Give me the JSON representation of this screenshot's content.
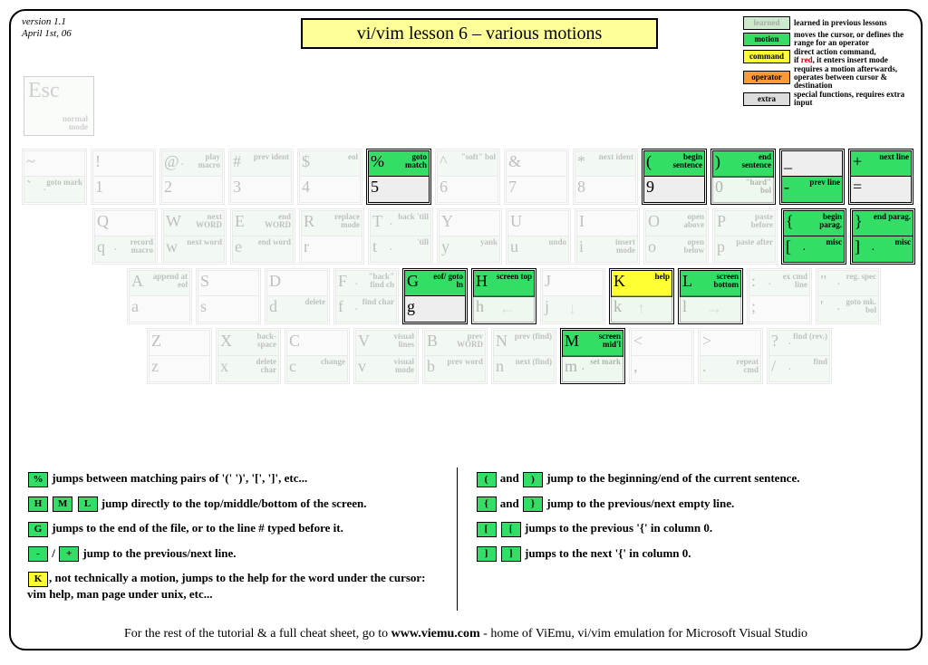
{
  "version": "version 1.1",
  "date": "April 1st, 06",
  "title": "vi/vim lesson 6 – various motions",
  "legend": {
    "learned": {
      "label": "learned",
      "text": "learned in previous lessons"
    },
    "motion": {
      "label": "motion",
      "text": "moves the cursor, or defines the range for an operator"
    },
    "command": {
      "label": "command",
      "text": "direct action command,"
    },
    "command2": "if",
    "command3": "red",
    "command4": ", it enters insert mode",
    "operator": {
      "label": "operator",
      "text": "requires a motion afterwards, operates between cursor & destination"
    },
    "extra": {
      "label": "extra",
      "text": "special functions, requires extra input"
    }
  },
  "esc": {
    "key": "Esc",
    "label": "normal\nmode"
  },
  "row1": [
    {
      "top": {
        "k": "~",
        "lbl": ""
      },
      "bot": {
        "k": "`",
        "lbl": "goto mark",
        "dot": "·"
      },
      "cls": "faded",
      "tcls": "c-blank",
      "bcls": "c-learned"
    },
    {
      "top": {
        "k": "!",
        "lbl": ""
      },
      "bot": {
        "k": "1",
        "lbl": ""
      },
      "cls": "faded",
      "tcls": "c-blank",
      "bcls": "c-blank"
    },
    {
      "top": {
        "k": "@",
        "lbl": "play macro",
        "dot": "·"
      },
      "bot": {
        "k": "2",
        "lbl": ""
      },
      "cls": "faded",
      "tcls": "c-learned",
      "bcls": "c-blank"
    },
    {
      "top": {
        "k": "#",
        "lbl": "prev ident"
      },
      "bot": {
        "k": "3",
        "lbl": ""
      },
      "cls": "faded",
      "tcls": "c-learned",
      "bcls": "c-blank"
    },
    {
      "top": {
        "k": "$",
        "lbl": "eol"
      },
      "bot": {
        "k": "4",
        "lbl": ""
      },
      "cls": "faded",
      "tcls": "c-learned",
      "bcls": "c-blank"
    },
    {
      "top": {
        "k": "%",
        "lbl": "goto match"
      },
      "bot": {
        "k": "5",
        "lbl": ""
      },
      "cls": "active",
      "tcls": "c-motion",
      "bcls": "c-blank"
    },
    {
      "top": {
        "k": "^",
        "lbl": "\"soft\" bol"
      },
      "bot": {
        "k": "6",
        "lbl": ""
      },
      "cls": "faded",
      "tcls": "c-learned",
      "bcls": "c-blank"
    },
    {
      "top": {
        "k": "&",
        "lbl": ""
      },
      "bot": {
        "k": "7",
        "lbl": ""
      },
      "cls": "faded",
      "tcls": "c-blank",
      "bcls": "c-blank"
    },
    {
      "top": {
        "k": "*",
        "lbl": "next ident"
      },
      "bot": {
        "k": "8",
        "lbl": ""
      },
      "cls": "faded",
      "tcls": "c-learned",
      "bcls": "c-blank"
    },
    {
      "top": {
        "k": "(",
        "lbl": "begin sentence"
      },
      "bot": {
        "k": "9",
        "lbl": ""
      },
      "cls": "active",
      "tcls": "c-motion",
      "bcls": "c-blank"
    },
    {
      "top": {
        "k": ")",
        "lbl": "end sentence"
      },
      "bot": {
        "k": "0",
        "lbl": "\"hard\" bol"
      },
      "cls": "active",
      "tcls": "c-motion",
      "bcls": "c-learned fadedhalf"
    },
    {
      "top": {
        "k": "_",
        "lbl": ""
      },
      "bot": {
        "k": "-",
        "lbl": "prev line"
      },
      "cls": "active",
      "tcls": "c-blank",
      "bcls": "c-motion"
    },
    {
      "top": {
        "k": "+",
        "lbl": "next line"
      },
      "bot": {
        "k": "=",
        "lbl": ""
      },
      "cls": "active",
      "tcls": "c-motion",
      "bcls": "c-blank"
    }
  ],
  "row2": [
    {
      "top": {
        "k": "Q",
        "lbl": ""
      },
      "bot": {
        "k": "q",
        "lbl": "record macro",
        "dot": "·"
      },
      "cls": "faded",
      "tcls": "c-blank",
      "bcls": "c-learned"
    },
    {
      "top": {
        "k": "W",
        "lbl": "next WORD"
      },
      "bot": {
        "k": "w",
        "lbl": "next word"
      },
      "cls": "faded",
      "tcls": "c-learned",
      "bcls": "c-learned"
    },
    {
      "top": {
        "k": "E",
        "lbl": "end WORD"
      },
      "bot": {
        "k": "e",
        "lbl": "end word"
      },
      "cls": "faded",
      "tcls": "c-learned",
      "bcls": "c-learned"
    },
    {
      "top": {
        "k": "R",
        "lbl": "replace mode"
      },
      "bot": {
        "k": "r",
        "lbl": ""
      },
      "cls": "faded",
      "tcls": "c-learned",
      "bcls": "c-blank"
    },
    {
      "top": {
        "k": "T",
        "lbl": "back 'till",
        "dot": "·"
      },
      "bot": {
        "k": "t",
        "lbl": "'till",
        "dot": "·"
      },
      "cls": "faded",
      "tcls": "c-learned",
      "bcls": "c-learned"
    },
    {
      "top": {
        "k": "Y",
        "lbl": ""
      },
      "bot": {
        "k": "y",
        "lbl": "yank"
      },
      "cls": "faded",
      "tcls": "c-blank",
      "bcls": "c-learned"
    },
    {
      "top": {
        "k": "U",
        "lbl": ""
      },
      "bot": {
        "k": "u",
        "lbl": "undo"
      },
      "cls": "faded",
      "tcls": "c-blank",
      "bcls": "c-learned"
    },
    {
      "top": {
        "k": "I",
        "lbl": ""
      },
      "bot": {
        "k": "i",
        "lbl": "insert mode"
      },
      "cls": "faded",
      "tcls": "c-blank",
      "bcls": "c-learned"
    },
    {
      "top": {
        "k": "O",
        "lbl": "open above"
      },
      "bot": {
        "k": "o",
        "lbl": "open below"
      },
      "cls": "faded",
      "tcls": "c-learned",
      "bcls": "c-learned"
    },
    {
      "top": {
        "k": "P",
        "lbl": "paste before"
      },
      "bot": {
        "k": "p",
        "lbl": "paste after"
      },
      "cls": "faded",
      "tcls": "c-learned",
      "bcls": "c-learned"
    },
    {
      "top": {
        "k": "{",
        "lbl": "begin parag."
      },
      "bot": {
        "k": "[",
        "lbl": "misc",
        "dot": "·"
      },
      "cls": "active",
      "tcls": "c-motion",
      "bcls": "c-motion"
    },
    {
      "top": {
        "k": "}",
        "lbl": "end parag."
      },
      "bot": {
        "k": "]",
        "lbl": "misc",
        "dot": "·"
      },
      "cls": "active",
      "tcls": "c-motion",
      "bcls": "c-motion"
    }
  ],
  "row3": [
    {
      "top": {
        "k": "A",
        "lbl": "append at eol"
      },
      "bot": {
        "k": "a",
        "lbl": ""
      },
      "cls": "faded",
      "tcls": "c-learned",
      "bcls": "c-blank"
    },
    {
      "top": {
        "k": "S",
        "lbl": ""
      },
      "bot": {
        "k": "s",
        "lbl": ""
      },
      "cls": "faded",
      "tcls": "c-blank",
      "bcls": "c-blank"
    },
    {
      "top": {
        "k": "D",
        "lbl": ""
      },
      "bot": {
        "k": "d",
        "lbl": "delete"
      },
      "cls": "faded",
      "tcls": "c-blank",
      "bcls": "c-learned"
    },
    {
      "top": {
        "k": "F",
        "lbl": "\"back\" find ch",
        "dot": "·"
      },
      "bot": {
        "k": "f",
        "lbl": "find char",
        "dot": "·"
      },
      "cls": "faded",
      "tcls": "c-learned",
      "bcls": "c-learned"
    },
    {
      "top": {
        "k": "G",
        "lbl": "eof/ goto ln"
      },
      "bot": {
        "k": "g",
        "lbl": ""
      },
      "cls": "active",
      "tcls": "c-motion",
      "bcls": "c-blank"
    },
    {
      "top": {
        "k": "H",
        "lbl": "screen top"
      },
      "bot": {
        "k": "h",
        "lbl": "",
        "arrow": "←"
      },
      "cls": "active",
      "tcls": "c-motion",
      "bcls": "c-learned fadedhalf"
    },
    {
      "top": {
        "k": "J",
        "lbl": ""
      },
      "bot": {
        "k": "j",
        "lbl": "",
        "arrow": "↓"
      },
      "cls": "faded",
      "tcls": "c-blank",
      "bcls": "c-learned"
    },
    {
      "top": {
        "k": "K",
        "lbl": "help"
      },
      "bot": {
        "k": "k",
        "lbl": "",
        "arrow": "↑"
      },
      "cls": "active",
      "tcls": "c-command",
      "bcls": "c-learned fadedhalf"
    },
    {
      "top": {
        "k": "L",
        "lbl": "screen bottom"
      },
      "bot": {
        "k": "l",
        "lbl": "",
        "arrow": "→"
      },
      "cls": "active",
      "tcls": "c-motion",
      "bcls": "c-learned fadedhalf"
    },
    {
      "top": {
        "k": ":",
        "lbl": "ex cmd line",
        "dot": "·"
      },
      "bot": {
        "k": ";",
        "lbl": ""
      },
      "cls": "faded",
      "tcls": "c-learned",
      "bcls": "c-blank"
    },
    {
      "top": {
        "k": "\"",
        "lbl": "reg. spec",
        "dot": "·"
      },
      "bot": {
        "k": "'",
        "lbl": "goto mk. bol",
        "dot": "·"
      },
      "cls": "faded",
      "tcls": "c-learned",
      "bcls": "c-learned"
    }
  ],
  "row4": [
    {
      "top": {
        "k": "Z",
        "lbl": ""
      },
      "bot": {
        "k": "z",
        "lbl": ""
      },
      "cls": "faded",
      "tcls": "c-blank",
      "bcls": "c-blank"
    },
    {
      "top": {
        "k": "X",
        "lbl": "back- space"
      },
      "bot": {
        "k": "x",
        "lbl": "delete char"
      },
      "cls": "faded",
      "tcls": "c-learned",
      "bcls": "c-learned"
    },
    {
      "top": {
        "k": "C",
        "lbl": ""
      },
      "bot": {
        "k": "c",
        "lbl": "change"
      },
      "cls": "faded",
      "tcls": "c-blank",
      "bcls": "c-learned"
    },
    {
      "top": {
        "k": "V",
        "lbl": "visual lines"
      },
      "bot": {
        "k": "v",
        "lbl": "visual mode"
      },
      "cls": "faded",
      "tcls": "c-learned",
      "bcls": "c-learned"
    },
    {
      "top": {
        "k": "B",
        "lbl": "prev WORD"
      },
      "bot": {
        "k": "b",
        "lbl": "prev word"
      },
      "cls": "faded",
      "tcls": "c-learned",
      "bcls": "c-learned"
    },
    {
      "top": {
        "k": "N",
        "lbl": "prev (find)"
      },
      "bot": {
        "k": "n",
        "lbl": "next (find)"
      },
      "cls": "faded",
      "tcls": "c-learned",
      "bcls": "c-learned"
    },
    {
      "top": {
        "k": "M",
        "lbl": "screen mid'l"
      },
      "bot": {
        "k": "m",
        "lbl": "set mark",
        "dot": "·"
      },
      "cls": "active",
      "tcls": "c-motion",
      "bcls": "c-learned fadedhalf"
    },
    {
      "top": {
        "k": "<",
        "lbl": ""
      },
      "bot": {
        "k": ",",
        "lbl": ""
      },
      "cls": "faded",
      "tcls": "c-blank",
      "bcls": "c-blank"
    },
    {
      "top": {
        "k": ">",
        "lbl": ""
      },
      "bot": {
        "k": ".",
        "lbl": "repeat cmd"
      },
      "cls": "faded",
      "tcls": "c-blank",
      "bcls": "c-learned"
    },
    {
      "top": {
        "k": "?",
        "lbl": "find (rev.)",
        "dot": "·"
      },
      "bot": {
        "k": "/",
        "lbl": "find",
        "dot": "·"
      },
      "cls": "faded",
      "tcls": "c-learned",
      "bcls": "c-learned"
    }
  ],
  "explain": {
    "l1_a": "%",
    "l1_b": " jumps between matching pairs of '(' ')', '[', ']',  etc...",
    "l2_a": "H",
    "l2_b": "M",
    "l2_c": "L",
    "l2_d": " jump directly to the top/middle/bottom of the screen.",
    "l3_a": "G",
    "l3_b": " jumps to the end of the file, or to the line # typed before it.",
    "l4_a": "-",
    "l4_b": "+",
    "l4_c": " jump to the previous/next line.",
    "l4_sep": " / ",
    "l5_a": "K",
    "l5_b": ", not technically a motion, jumps to the help for the word under the cursor: vim help, man page under unix, etc...",
    "r1_a": "(",
    "r1_b": ")",
    "r1_c": " jump to the beginning/end of the current sentence.",
    "r_and": " and ",
    "r2_a": "{",
    "r2_b": "}",
    "r2_c": " jump to the previous/next empty line.",
    "r3_a": "[",
    "r3_b": "[",
    "r3_c": " jumps to the previous '{' in column 0.",
    "r4_a": "]",
    "r4_b": "]",
    "r4_c": " jumps to the next '{' in column 0."
  },
  "footer_a": "For the rest of the tutorial & a full cheat sheet, go to ",
  "footer_b": "www.viemu.com",
  "footer_c": " - home of ViEmu, vi/vim emulation for Microsoft Visual Studio"
}
